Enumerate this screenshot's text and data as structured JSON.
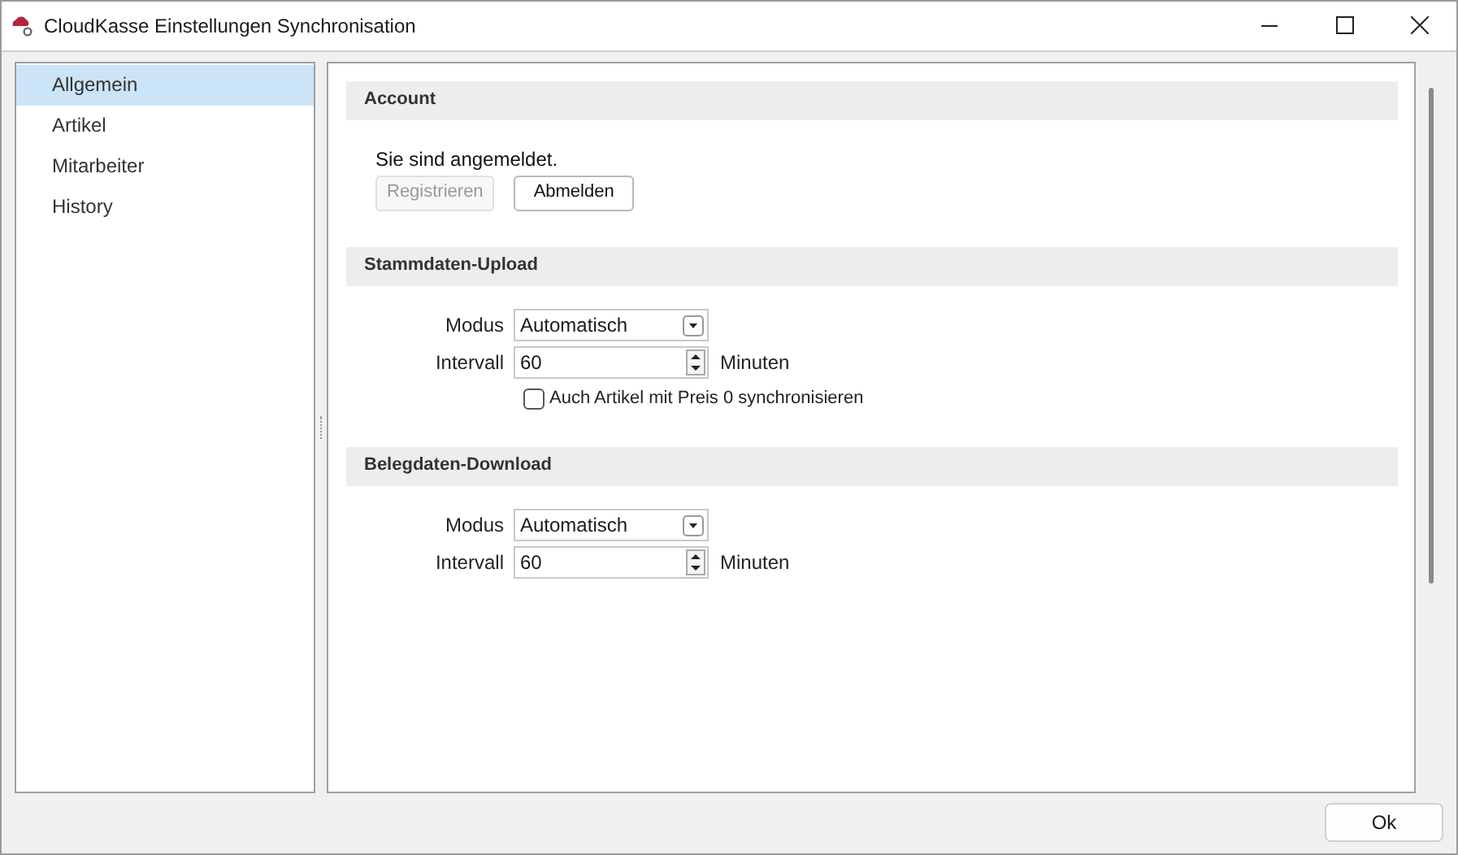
{
  "window": {
    "title": "CloudKasse Einstellungen Synchronisation"
  },
  "sidebar": {
    "items": [
      {
        "label": "Allgemein",
        "selected": true
      },
      {
        "label": "Artikel",
        "selected": false
      },
      {
        "label": "Mitarbeiter",
        "selected": false
      },
      {
        "label": "History",
        "selected": false
      }
    ]
  },
  "sections": [
    {
      "title": "Account",
      "status": "Sie sind angemeldet.",
      "buttons": [
        {
          "label": "Registrieren",
          "disabled": true
        },
        {
          "label": "Abmelden",
          "disabled": false
        }
      ]
    },
    {
      "title": "Stammdaten-Upload",
      "fields": [
        {
          "kind": "select",
          "label": "Modus",
          "value": "Automatisch"
        },
        {
          "kind": "spinner",
          "label": "Intervall",
          "value": "60",
          "unit": "Minuten"
        }
      ],
      "checkbox": {
        "label": "Auch Artikel mit Preis 0 synchronisieren",
        "checked": false
      }
    },
    {
      "title": "Belegdaten-Download",
      "fields": [
        {
          "kind": "select",
          "label": "Modus",
          "value": "Automatisch"
        },
        {
          "kind": "spinner",
          "label": "Intervall",
          "value": "60",
          "unit": "Minuten"
        }
      ]
    }
  ],
  "footer": {
    "buttons": [
      "Ok"
    ]
  }
}
